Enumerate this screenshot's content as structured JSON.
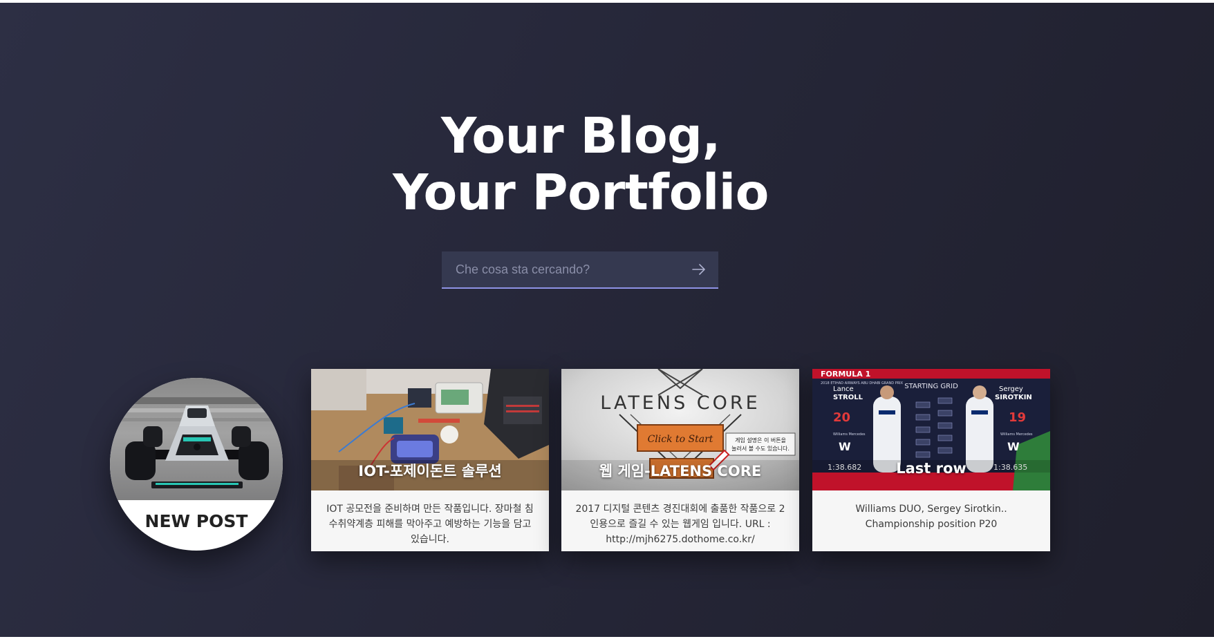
{
  "hero": {
    "title_line1": "Your Blog,",
    "title_line2": "Your Portfolio"
  },
  "search": {
    "placeholder": "Che cosa sta cercando?",
    "submit_icon": "arrow-right-icon"
  },
  "new_post": {
    "label": "NEW POST",
    "image": "f1-race-car"
  },
  "cards": [
    {
      "title": "IOT-포제이돈트 솔루션",
      "description": "IOT 공모전을 준비하며 만든 작품입니다. 장마철 침수취약계층 피해를 막아주고 예방하는 기능을 담고 있습니다.",
      "image": "iot-prototype-board"
    },
    {
      "title": "웹 게임-LATENS CORE",
      "description": "2017 디지털 콘텐츠 경진대회에 출품한 작품으로 2인용으로 즐길 수 있는 웹게임 입니다. URL : http://mjh6275.dothome.co.kr/",
      "image": "latens-core-game-screen",
      "image_text": {
        "logo": "LATENS CORE",
        "button": "Click to Start",
        "note_line1": "게임 설명은 이 버튼을",
        "note_line2": "눌러서 볼 수도 있습니다."
      }
    },
    {
      "title": "Last row",
      "description": "Williams DUO, Sergey Sirotkin.. Championship position P20",
      "image": "f1-starting-grid",
      "image_text": {
        "banner": "FORMULA 1",
        "race": "2018 ETIHAD AIRWAYS ABU DHABI GRAND PRIX",
        "heading": "STARTING GRID",
        "driver1_first": "Lance",
        "driver1_last": "STROLL",
        "driver1_pos": "20",
        "driver1_time": "1:38.682",
        "driver2_first": "Sergey",
        "driver2_last": "SIROTKIN",
        "driver2_pos": "19",
        "driver2_time": "1:38.635",
        "team": "Williams Mercedes"
      }
    }
  ],
  "colors": {
    "hero_bg": "#262739",
    "search_bg": "#353950",
    "search_underline": "#8f93e6",
    "card_bg": "#f6f6f6",
    "title_text": "#ffffff"
  }
}
